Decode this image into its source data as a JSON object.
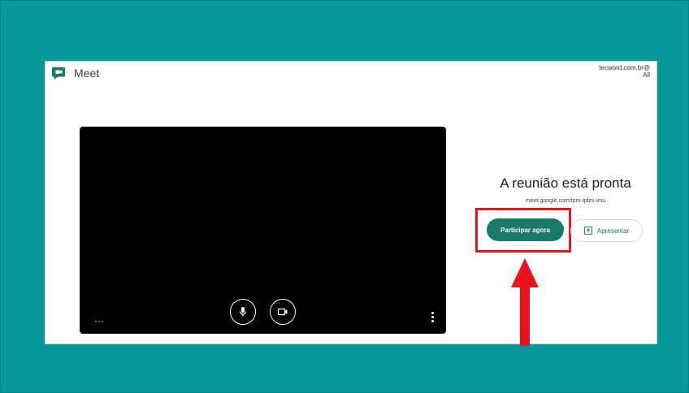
{
  "app": {
    "name": "Meet"
  },
  "account": {
    "line1": "tecword.com.br@",
    "line2": "All"
  },
  "lobby": {
    "ready_text": "A reunião está pronta",
    "meeting_url": "meet.google.com/tpm-qdzs-vnu",
    "join_label": "Participar agora",
    "present_label": "Apresentar"
  },
  "icons": {
    "logo": "google-meet-icon",
    "mic": "microphone-icon",
    "camera": "video-camera-icon",
    "more_options": "more-vert-icon",
    "present": "present-screen-icon",
    "effects": "more-horiz-icon"
  },
  "colors": {
    "background": "#06999c",
    "join_button": "#1a7a6a",
    "highlight": "#e8141b",
    "arrow": "#e8141b"
  }
}
